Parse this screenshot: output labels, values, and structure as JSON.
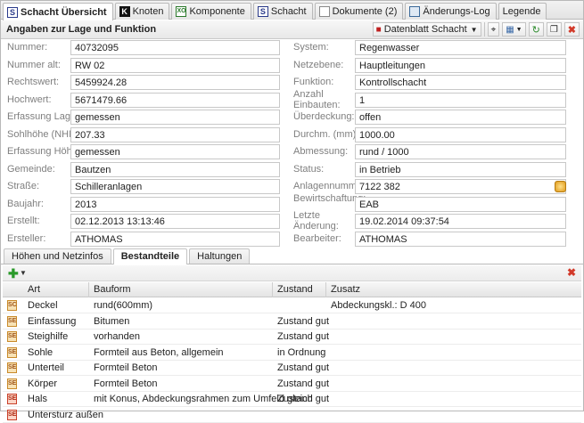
{
  "tabs": [
    {
      "label": "Schacht Übersicht",
      "icon": "s",
      "active": true
    },
    {
      "label": "Knoten",
      "icon": "k",
      "active": false
    },
    {
      "label": "Komponente",
      "icon": "xo",
      "active": false
    },
    {
      "label": "Schacht",
      "icon": "s",
      "active": false
    },
    {
      "label": "Dokumente (2)",
      "icon": "doc",
      "active": false
    },
    {
      "label": "Änderungs-Log",
      "icon": "log",
      "active": false
    },
    {
      "label": "Legende",
      "icon": "",
      "active": false
    }
  ],
  "header": {
    "title": "Angaben zur Lage und Funktion",
    "datenblatt_label": "Datenblatt Schacht"
  },
  "left_fields": [
    {
      "label": "Nummer:",
      "value": "40732095"
    },
    {
      "label": "Nummer alt:",
      "value": "RW 02"
    },
    {
      "label": "Rechtswert:",
      "value": "5459924.28"
    },
    {
      "label": "Hochwert:",
      "value": "5671479.66"
    },
    {
      "label": "Erfassung Lage:",
      "value": "gemessen"
    },
    {
      "label": "Sohlhöhe (NHN):",
      "value": "207.33"
    },
    {
      "label": "Erfassung Höhe:",
      "value": "gemessen"
    },
    {
      "label": "Gemeinde:",
      "value": "Bautzen"
    },
    {
      "label": "Straße:",
      "value": "Schilleranlagen"
    },
    {
      "label": "Baujahr:",
      "value": "2013"
    },
    {
      "label": "Erstellt:",
      "value": "02.12.2013 13:13:46"
    },
    {
      "label": "Ersteller:",
      "value": "ATHOMAS"
    }
  ],
  "right_fields": [
    {
      "label": "System:",
      "value": "Regenwasser"
    },
    {
      "label": "Netzebene:",
      "value": "Hauptleitungen"
    },
    {
      "label": "Funktion:",
      "value": "Kontrollschacht"
    },
    {
      "label": "Anzahl Einbauten:",
      "value": "1"
    },
    {
      "label": "Überdeckung:",
      "value": "offen"
    },
    {
      "label": "Durchm. (mm):",
      "value": "1000.00"
    },
    {
      "label": "Abmessung:",
      "value": "rund / 1000"
    },
    {
      "label": "Status:",
      "value": "in Betrieb"
    },
    {
      "label": "Anlagennummer:",
      "value": "7122 382"
    },
    {
      "label": "Bewirtschaftung:",
      "value": "EAB"
    },
    {
      "label": "Letzte Änderung:",
      "value": "19.02.2014 09:37:54"
    },
    {
      "label": "Bearbeiter:",
      "value": "ATHOMAS"
    }
  ],
  "subtabs": [
    {
      "label": "Höhen und Netzinfos",
      "active": false
    },
    {
      "label": "Bestandteile",
      "active": true
    },
    {
      "label": "Haltungen",
      "active": false
    }
  ],
  "grid": {
    "columns": [
      "Art",
      "Bauform",
      "Zustand",
      "Zusatz"
    ],
    "rows": [
      {
        "icon": "SC",
        "color": "orange",
        "art": "Deckel",
        "bauform": "rund(600mm)",
        "zustand": "",
        "zusatz": "Abdeckungskl.: D 400"
      },
      {
        "icon": "SE",
        "color": "orange",
        "art": "Einfassung",
        "bauform": "Bitumen",
        "zustand": "Zustand gut",
        "zusatz": ""
      },
      {
        "icon": "SE",
        "color": "orange",
        "art": "Steighilfe",
        "bauform": "vorhanden",
        "zustand": "Zustand gut",
        "zusatz": ""
      },
      {
        "icon": "SE",
        "color": "orange",
        "art": "Sohle",
        "bauform": "Formteil aus Beton, allgemein",
        "zustand": "in Ordnung",
        "zusatz": ""
      },
      {
        "icon": "SE",
        "color": "orange",
        "art": "Unterteil",
        "bauform": "Formteil Beton",
        "zustand": "Zustand gut",
        "zusatz": ""
      },
      {
        "icon": "SE",
        "color": "orange",
        "art": "Körper",
        "bauform": "Formteil Beton",
        "zustand": "Zustand gut",
        "zusatz": ""
      },
      {
        "icon": "SE",
        "color": "red",
        "art": "Hals",
        "bauform": "mit Konus, Abdeckungsrahmen zum Umfeld gleich",
        "zustand": "Zustand gut",
        "zusatz": ""
      },
      {
        "icon": "SE",
        "color": "red",
        "art": "Untersturz außen",
        "bauform": "",
        "zustand": "",
        "zusatz": ""
      }
    ]
  }
}
